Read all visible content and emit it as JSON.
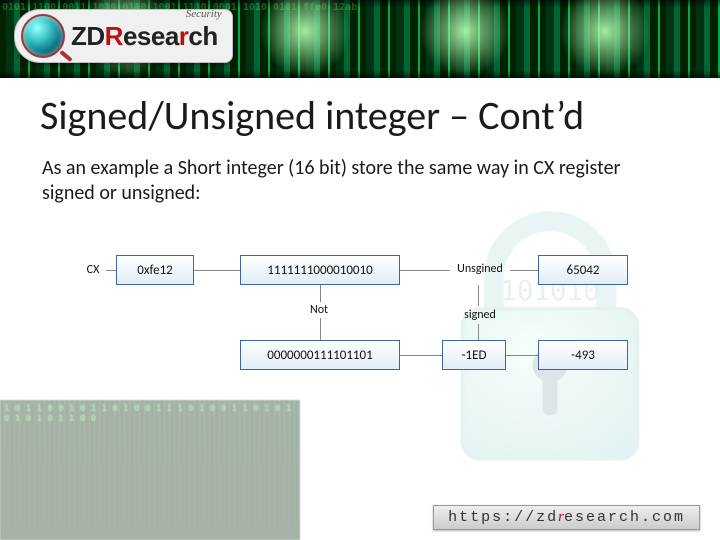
{
  "logo": {
    "tagline": "Security",
    "name_prefix": "ZD",
    "name_mid": "R",
    "name_rest1": "esea",
    "name_mid2": "r",
    "name_rest2": "ch"
  },
  "title": "Signed/Unsigned integer – Cont’d",
  "subtitle": "As an example a Short integer (16 bit) store the same way in CX register signed or unsigned:",
  "diagram": {
    "cx_label": "CX",
    "hex": "0xfe12",
    "bin_original": "1111111000010010",
    "unsigned_label": "Unsgined",
    "unsigned_dec": "65042",
    "not_label": "Not",
    "signed_label": "signed",
    "bin_not": "0000000111101101",
    "neg_hex": "-1ED",
    "signed_dec": "-493"
  },
  "footer": {
    "scheme": "https://",
    "host_pre": "zd",
    "host_r": "r",
    "host_post": "esearch.com"
  }
}
